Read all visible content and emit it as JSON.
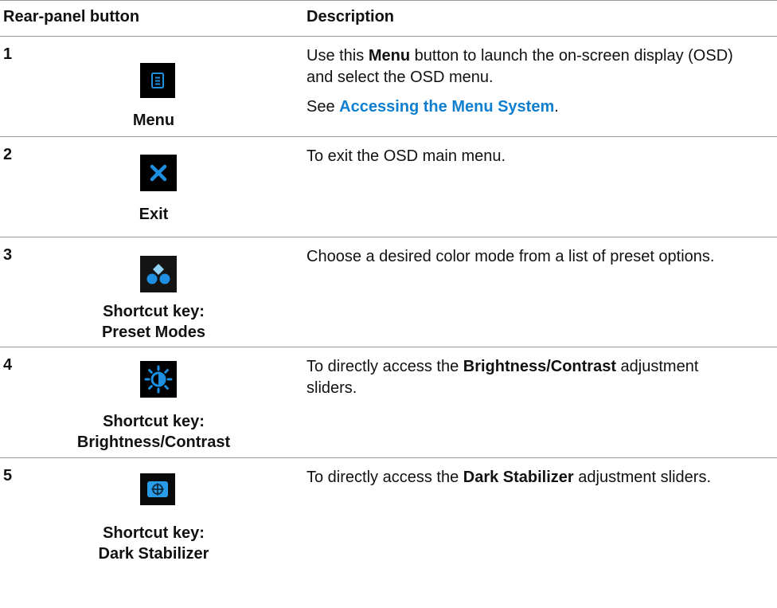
{
  "table": {
    "header": {
      "col_button": "Rear-panel button",
      "col_description": "Description"
    },
    "rows": [
      {
        "number": "1",
        "icon": "menu-icon",
        "caption_line1": "Menu",
        "caption_line2": "",
        "desc_prefix": "Use this ",
        "desc_bold": "Menu",
        "desc_suffix": " button to launch the on-screen display (OSD) and select the OSD menu.",
        "see_prefix": "See ",
        "see_link": "Accessing the Menu System",
        "see_suffix": "."
      },
      {
        "number": "2",
        "icon": "exit-x-icon",
        "caption_line1": "Exit",
        "caption_line2": "",
        "desc_text": "To exit the OSD main menu."
      },
      {
        "number": "3",
        "icon": "preset-modes-icon",
        "caption_line1": "Shortcut key:",
        "caption_line2": "Preset Modes",
        "desc_text": "Choose a desired color mode from a list of preset options."
      },
      {
        "number": "4",
        "icon": "brightness-contrast-icon",
        "caption_line1": "Shortcut key:",
        "caption_line2": "Brightness/Contrast",
        "desc_prefix": "To directly access the ",
        "desc_bold": "Brightness/Contrast",
        "desc_suffix": " adjustment sliders."
      },
      {
        "number": "5",
        "icon": "dark-stabilizer-icon",
        "caption_line1": "Shortcut key:",
        "caption_line2": "Dark Stabilizer",
        "desc_prefix": "To directly access the ",
        "desc_bold": "Dark Stabilizer",
        "desc_suffix": " adjustment sliders."
      }
    ]
  },
  "colors": {
    "icon_blue": "#1e8fe0",
    "link_blue": "#0e7fd0",
    "rule_gray": "#9a9a9a"
  }
}
